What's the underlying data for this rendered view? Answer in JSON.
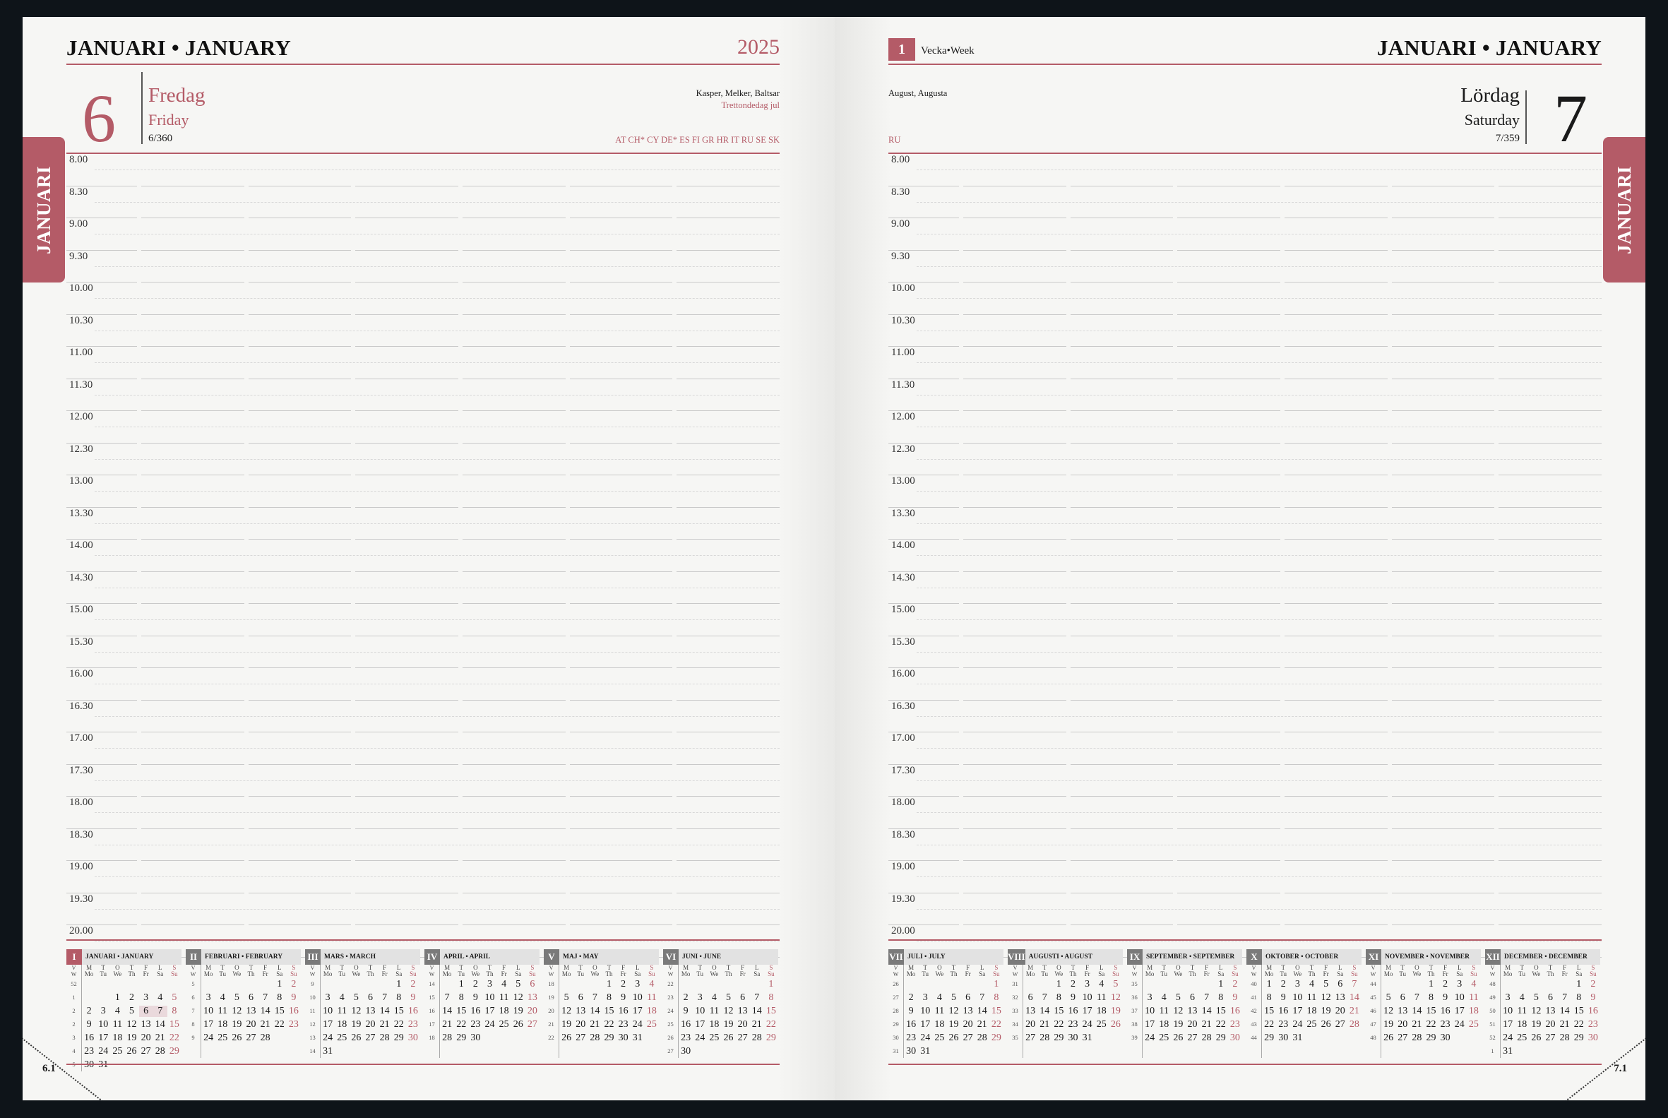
{
  "left": {
    "month": "JANUARI • JANUARY",
    "year": "2025",
    "day_number": "6",
    "weekday_sv": "Fredag",
    "weekday_en": "Friday",
    "day_count": "6/360",
    "names": "Kasper, Melker, Baltsar",
    "holiday": "Trettondedag jul",
    "countries": "AT CH* CY DE* ES FI GR HR IT RU SE SK",
    "tab_label": "JANUARI",
    "page_number": "6.1"
  },
  "right": {
    "month": "JANUARI • JANUARY",
    "week_number": "1",
    "week_label": "Vecka•Week",
    "day_number": "7",
    "weekday_sv": "Lördag",
    "weekday_en": "Saturday",
    "day_count": "7/359",
    "names": "August, Augusta",
    "countries": "RU",
    "tab_label": "JANUARI",
    "page_number": "7.1"
  },
  "times": [
    "8.00",
    "8.30",
    "9.00",
    "9.30",
    "10.00",
    "10.30",
    "11.00",
    "11.30",
    "12.00",
    "12.30",
    "13.00",
    "13.30",
    "14.00",
    "14.30",
    "15.00",
    "15.30",
    "16.00",
    "16.30",
    "17.00",
    "17.30",
    "18.00",
    "18.30",
    "19.00",
    "19.30",
    "20.00"
  ],
  "day_headers": {
    "letters": [
      "M",
      "T",
      "O",
      "T",
      "F",
      "L",
      "S"
    ],
    "en": [
      "Mo",
      "Tu",
      "We",
      "Th",
      "Fr",
      "Sa",
      "Su"
    ],
    "week": "V",
    "week_en": "W"
  },
  "mini_calendars_left": [
    {
      "num": "I",
      "title": "JANUARI • JANUARY",
      "current": true,
      "weeks": [
        {
          "w": "52",
          "d": [
            "",
            "",
            "",
            "",
            "",
            "",
            ""
          ]
        },
        {
          "w": "1",
          "d": [
            "",
            "",
            "1",
            "2",
            "3",
            "4",
            "5"
          ]
        },
        {
          "w": "2",
          "d": [
            "",
            "2",
            "3",
            "4",
            "5",
            "6",
            "7",
            "8"
          ]
        },
        {
          "w": "2",
          "d": [
            "9",
            "10",
            "11",
            "12",
            "13",
            "14",
            "15"
          ]
        },
        {
          "w": "3",
          "d": [
            "16",
            "17",
            "18",
            "19",
            "20",
            "21",
            "22"
          ]
        },
        {
          "w": "4",
          "d": [
            "23",
            "24",
            "25",
            "26",
            "27",
            "28",
            "29"
          ]
        },
        {
          "w": "5",
          "d": [
            "30",
            "31",
            "",
            "",
            "",
            "",
            ""
          ]
        }
      ]
    },
    {
      "num": "II",
      "title": "FEBRUARI • FEBRUARY",
      "weeks": [
        {
          "w": "5",
          "d": [
            "",
            "",
            "",
            "",
            "",
            "1",
            "2"
          ]
        },
        {
          "w": "6",
          "d": [
            "3",
            "4",
            "5",
            "6",
            "7",
            "8",
            "9"
          ]
        },
        {
          "w": "7",
          "d": [
            "10",
            "11",
            "12",
            "13",
            "14",
            "15",
            "16"
          ]
        },
        {
          "w": "8",
          "d": [
            "17",
            "18",
            "19",
            "20",
            "21",
            "22",
            "23"
          ]
        },
        {
          "w": "9",
          "d": [
            "24",
            "25",
            "26",
            "27",
            "28",
            "",
            ""
          ]
        },
        {
          "w": "",
          "d": [
            "",
            "",
            "",
            "",
            "",
            "",
            ""
          ]
        }
      ]
    },
    {
      "num": "III",
      "title": "MARS • MARCH",
      "weeks": [
        {
          "w": "9",
          "d": [
            "",
            "",
            "",
            "",
            "",
            "1",
            "2"
          ]
        },
        {
          "w": "10",
          "d": [
            "3",
            "4",
            "5",
            "6",
            "7",
            "8",
            "9"
          ]
        },
        {
          "w": "11",
          "d": [
            "10",
            "11",
            "12",
            "13",
            "14",
            "15",
            "16"
          ]
        },
        {
          "w": "12",
          "d": [
            "17",
            "18",
            "19",
            "20",
            "21",
            "22",
            "23"
          ]
        },
        {
          "w": "13",
          "d": [
            "24",
            "25",
            "26",
            "27",
            "28",
            "29",
            "30"
          ]
        },
        {
          "w": "14",
          "d": [
            "31",
            "",
            "",
            "",
            "",
            "",
            ""
          ]
        }
      ]
    },
    {
      "num": "IV",
      "title": "APRIL • APRIL",
      "weeks": [
        {
          "w": "14",
          "d": [
            "",
            "1",
            "2",
            "3",
            "4",
            "5",
            "6"
          ]
        },
        {
          "w": "15",
          "d": [
            "7",
            "8",
            "9",
            "10",
            "11",
            "12",
            "13"
          ]
        },
        {
          "w": "16",
          "d": [
            "14",
            "15",
            "16",
            "17",
            "18",
            "19",
            "20"
          ]
        },
        {
          "w": "17",
          "d": [
            "21",
            "22",
            "23",
            "24",
            "25",
            "26",
            "27"
          ]
        },
        {
          "w": "18",
          "d": [
            "28",
            "29",
            "30",
            "",
            "",
            "",
            ""
          ]
        },
        {
          "w": "",
          "d": [
            "",
            "",
            "",
            "",
            "",
            "",
            ""
          ]
        }
      ]
    },
    {
      "num": "V",
      "title": "MAJ • MAY",
      "weeks": [
        {
          "w": "18",
          "d": [
            "",
            "",
            "",
            "1",
            "2",
            "3",
            "4"
          ]
        },
        {
          "w": "19",
          "d": [
            "5",
            "6",
            "7",
            "8",
            "9",
            "10",
            "11"
          ]
        },
        {
          "w": "20",
          "d": [
            "12",
            "13",
            "14",
            "15",
            "16",
            "17",
            "18"
          ]
        },
        {
          "w": "21",
          "d": [
            "19",
            "20",
            "21",
            "22",
            "23",
            "24",
            "25"
          ]
        },
        {
          "w": "22",
          "d": [
            "26",
            "27",
            "28",
            "29",
            "30",
            "31",
            ""
          ]
        },
        {
          "w": "",
          "d": [
            "",
            "",
            "",
            "",
            "",
            "",
            ""
          ]
        }
      ]
    },
    {
      "num": "VI",
      "title": "JUNI • JUNE",
      "weeks": [
        {
          "w": "22",
          "d": [
            "",
            "",
            "",
            "",
            "",
            "",
            "1"
          ]
        },
        {
          "w": "23",
          "d": [
            "2",
            "3",
            "4",
            "5",
            "6",
            "7",
            "8"
          ]
        },
        {
          "w": "24",
          "d": [
            "9",
            "10",
            "11",
            "12",
            "13",
            "14",
            "15"
          ]
        },
        {
          "w": "25",
          "d": [
            "16",
            "17",
            "18",
            "19",
            "20",
            "21",
            "22"
          ]
        },
        {
          "w": "26",
          "d": [
            "23",
            "24",
            "25",
            "26",
            "27",
            "28",
            "29"
          ]
        },
        {
          "w": "27",
          "d": [
            "30",
            "",
            "",
            "",
            "",
            "",
            ""
          ]
        }
      ]
    }
  ],
  "mini_calendars_right": [
    {
      "num": "VII",
      "title": "JULI • JULY",
      "weeks": [
        {
          "w": "26",
          "d": [
            "",
            "",
            "",
            "",
            "",
            "",
            "1"
          ]
        },
        {
          "w": "27",
          "d": [
            "2",
            "3",
            "4",
            "5",
            "6",
            "7",
            "8"
          ]
        },
        {
          "w": "28",
          "d": [
            "9",
            "10",
            "11",
            "12",
            "13",
            "14",
            "15"
          ]
        },
        {
          "w": "29",
          "d": [
            "16",
            "17",
            "18",
            "19",
            "20",
            "21",
            "22"
          ]
        },
        {
          "w": "30",
          "d": [
            "23",
            "24",
            "25",
            "26",
            "27",
            "28",
            "29"
          ]
        },
        {
          "w": "31",
          "d": [
            "30",
            "31",
            "",
            "",
            "",
            "",
            ""
          ]
        }
      ]
    },
    {
      "num": "VIII",
      "title": "AUGUSTI • AUGUST",
      "weeks": [
        {
          "w": "31",
          "d": [
            "",
            "",
            "",
            "1",
            "2",
            "3",
            "4",
            "5"
          ]
        },
        {
          "w": "32",
          "d": [
            "6",
            "7",
            "8",
            "9",
            "10",
            "11",
            "12"
          ]
        },
        {
          "w": "33",
          "d": [
            "13",
            "14",
            "15",
            "16",
            "17",
            "18",
            "19"
          ]
        },
        {
          "w": "34",
          "d": [
            "20",
            "21",
            "22",
            "23",
            "24",
            "25",
            "26"
          ]
        },
        {
          "w": "35",
          "d": [
            "27",
            "28",
            "29",
            "30",
            "31",
            "",
            ""
          ]
        },
        {
          "w": "",
          "d": [
            "",
            "",
            "",
            "",
            "",
            "",
            ""
          ]
        }
      ]
    },
    {
      "num": "IX",
      "title": "SEPTEMBER • SEPTEMBER",
      "weeks": [
        {
          "w": "35",
          "d": [
            "",
            "",
            "",
            "",
            "",
            "1",
            "2"
          ]
        },
        {
          "w": "36",
          "d": [
            "3",
            "4",
            "5",
            "6",
            "7",
            "8",
            "9"
          ]
        },
        {
          "w": "37",
          "d": [
            "10",
            "11",
            "12",
            "13",
            "14",
            "15",
            "16"
          ]
        },
        {
          "w": "38",
          "d": [
            "17",
            "18",
            "19",
            "20",
            "21",
            "22",
            "23"
          ]
        },
        {
          "w": "39",
          "d": [
            "24",
            "25",
            "26",
            "27",
            "28",
            "29",
            "30"
          ]
        },
        {
          "w": "",
          "d": [
            "",
            "",
            "",
            "",
            "",
            "",
            ""
          ]
        }
      ]
    },
    {
      "num": "X",
      "title": "OKTOBER • OCTOBER",
      "weeks": [
        {
          "w": "40",
          "d": [
            "1",
            "2",
            "3",
            "4",
            "5",
            "6",
            "7"
          ]
        },
        {
          "w": "41",
          "d": [
            "8",
            "9",
            "10",
            "11",
            "12",
            "13",
            "14"
          ]
        },
        {
          "w": "42",
          "d": [
            "15",
            "16",
            "17",
            "18",
            "19",
            "20",
            "21"
          ]
        },
        {
          "w": "43",
          "d": [
            "22",
            "23",
            "24",
            "25",
            "26",
            "27",
            "28"
          ]
        },
        {
          "w": "44",
          "d": [
            "29",
            "30",
            "31",
            "",
            "",
            "",
            ""
          ]
        },
        {
          "w": "",
          "d": [
            "",
            "",
            "",
            "",
            "",
            "",
            ""
          ]
        }
      ]
    },
    {
      "num": "XI",
      "title": "NOVEMBER • NOVEMBER",
      "weeks": [
        {
          "w": "44",
          "d": [
            "",
            "",
            "",
            "",
            "1",
            "2",
            "3",
            "4"
          ]
        },
        {
          "w": "45",
          "d": [
            "5",
            "6",
            "7",
            "8",
            "9",
            "10",
            "11"
          ]
        },
        {
          "w": "46",
          "d": [
            "12",
            "13",
            "14",
            "15",
            "16",
            "17",
            "18"
          ]
        },
        {
          "w": "47",
          "d": [
            "19",
            "20",
            "21",
            "22",
            "23",
            "24",
            "25"
          ]
        },
        {
          "w": "48",
          "d": [
            "26",
            "27",
            "28",
            "29",
            "30",
            "",
            ""
          ]
        },
        {
          "w": "",
          "d": [
            "",
            "",
            "",
            "",
            "",
            "",
            ""
          ]
        }
      ]
    },
    {
      "num": "XII",
      "title": "DECEMBER • DECEMBER",
      "weeks": [
        {
          "w": "48",
          "d": [
            "",
            "",
            "",
            "",
            "",
            "1",
            "2"
          ]
        },
        {
          "w": "49",
          "d": [
            "3",
            "4",
            "5",
            "6",
            "7",
            "8",
            "9"
          ]
        },
        {
          "w": "50",
          "d": [
            "10",
            "11",
            "12",
            "13",
            "14",
            "15",
            "16"
          ]
        },
        {
          "w": "51",
          "d": [
            "17",
            "18",
            "19",
            "20",
            "21",
            "22",
            "23"
          ]
        },
        {
          "w": "52",
          "d": [
            "24",
            "25",
            "26",
            "27",
            "28",
            "29",
            "30"
          ]
        },
        {
          "w": "1",
          "d": [
            "31",
            "",
            "",
            "",
            "",
            "",
            ""
          ]
        }
      ]
    }
  ],
  "colors": {
    "accent": "#b45b67",
    "background": "#0e1419",
    "paper": "#f6f6f4"
  }
}
